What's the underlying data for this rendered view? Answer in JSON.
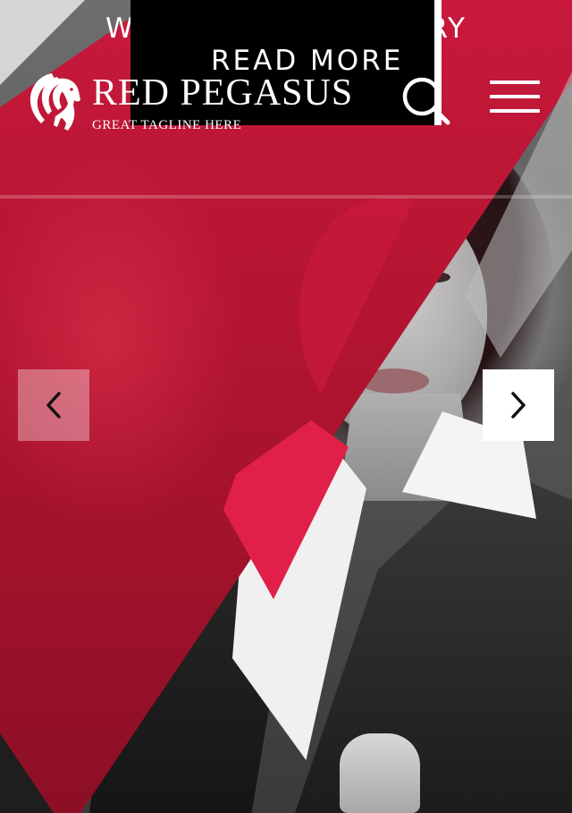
{
  "announcement": {
    "left_fragment": "WI",
    "right_fragment": "RY",
    "cta_label": "READ MORE"
  },
  "header": {
    "brand_name": "RED PEGASUS",
    "tagline": "GREAT TAGLINE HERE",
    "logo_icon": "pegasus-logo-icon",
    "search_icon": "search-icon",
    "menu_icon": "hamburger-menu-icon"
  },
  "slider": {
    "prev_icon": "chevron-left-icon",
    "next_icon": "chevron-right-icon"
  },
  "colors": {
    "brand_red": "#c8193c",
    "white": "#ffffff",
    "black": "#000000"
  }
}
